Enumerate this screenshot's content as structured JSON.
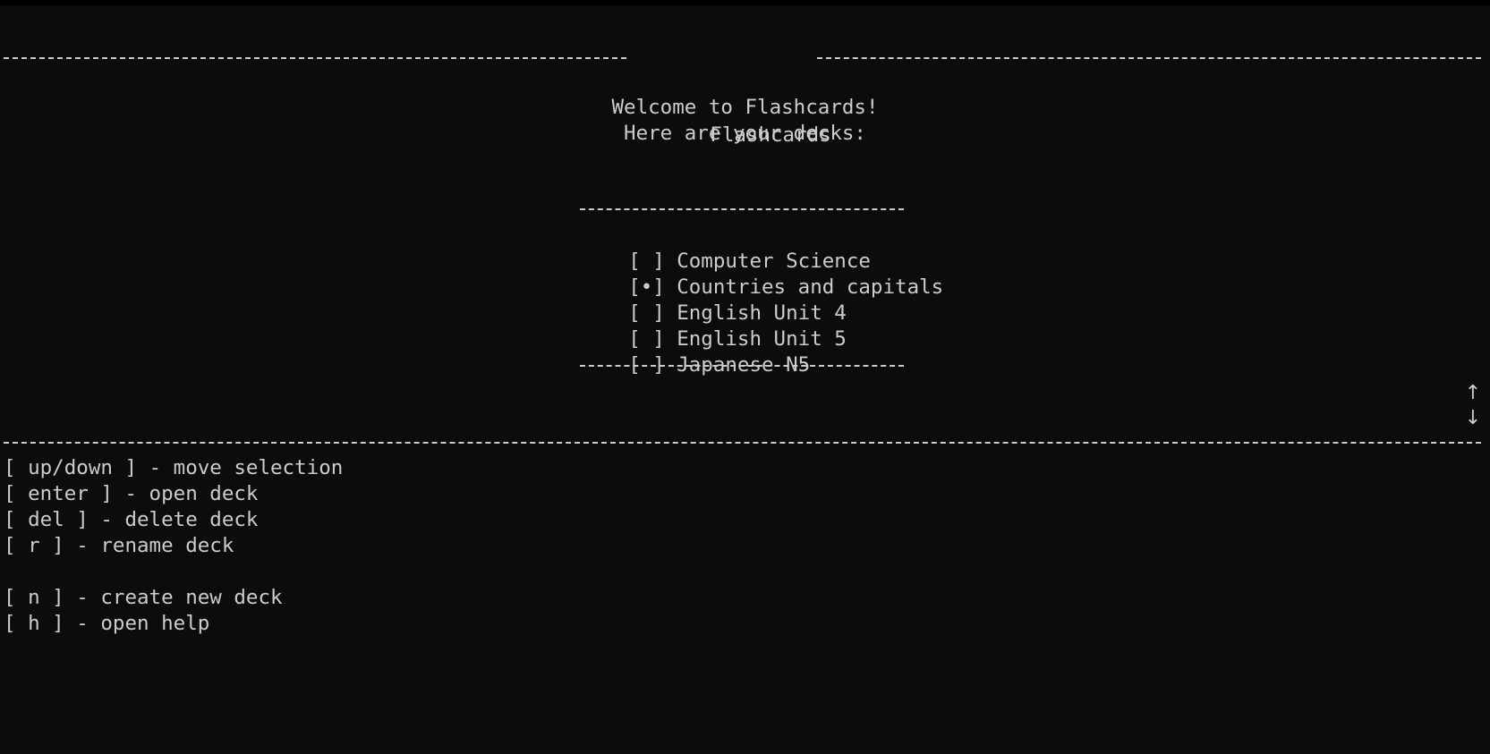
{
  "header": {
    "title": "Flashcards"
  },
  "welcome": {
    "line1": "Welcome to Flashcards!",
    "line2": "Here are your decks:"
  },
  "decks": [
    {
      "marker": "[ ]",
      "label": "Computer Science",
      "selected": false
    },
    {
      "marker": "[•]",
      "label": "Countries and capitals",
      "selected": true
    },
    {
      "marker": "[ ]",
      "label": "English Unit 4",
      "selected": false
    },
    {
      "marker": "[ ]",
      "label": "English Unit 5",
      "selected": false
    },
    {
      "marker": "[ ]",
      "label": "Japanese N5",
      "selected": false
    }
  ],
  "scroll": {
    "up": "↑",
    "down": "↓"
  },
  "keybindings": [
    {
      "text": "[ up/down ] - move selection"
    },
    {
      "text": "[ enter ] - open deck"
    },
    {
      "text": "[ del ] - delete deck"
    },
    {
      "text": "[ r ] - rename deck"
    },
    {
      "text": "[ n ] - create new deck"
    },
    {
      "text": "[ h ] - open help"
    }
  ],
  "colors": {
    "background": "#0c0c0c",
    "foreground": "#cccccc"
  }
}
